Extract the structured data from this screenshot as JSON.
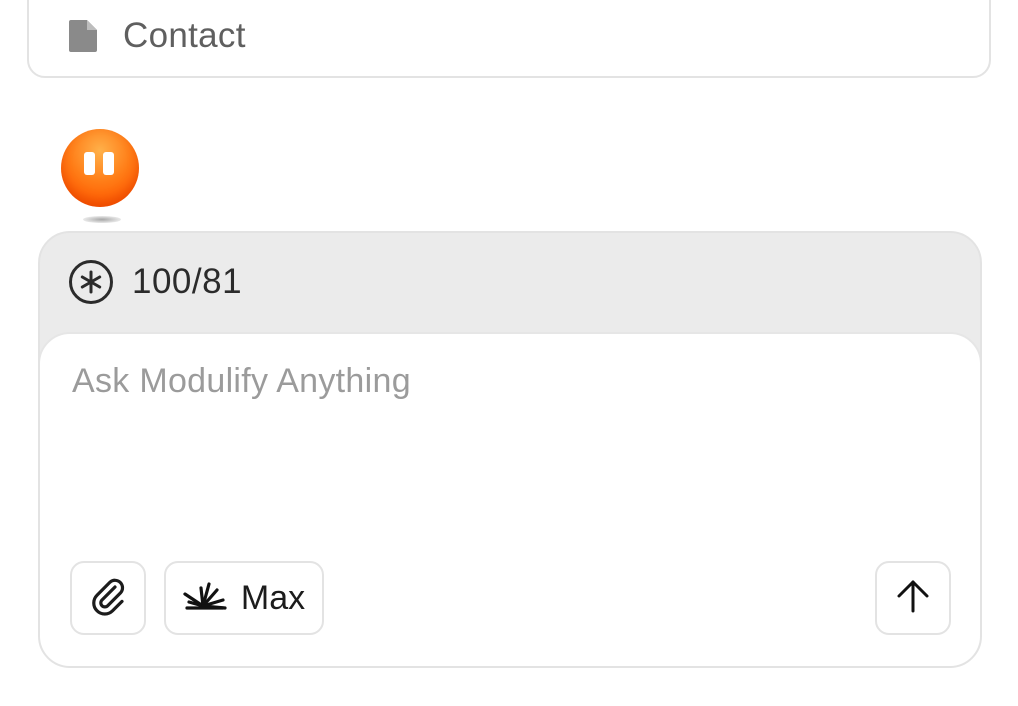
{
  "contact_card": {
    "label": "Contact",
    "icon": "document-icon"
  },
  "assistant": {
    "avatar_color": "#ff6a08"
  },
  "composer": {
    "credits": {
      "icon": "asterisk-circle-icon",
      "text": "100/81"
    },
    "input": {
      "placeholder": "Ask Modulify Anything",
      "value": ""
    },
    "attach_button": {
      "icon": "paperclip-icon"
    },
    "model_selector": {
      "icon": "sparkburst-icon",
      "label": "Max"
    },
    "send_button": {
      "icon": "arrow-up-icon"
    }
  }
}
